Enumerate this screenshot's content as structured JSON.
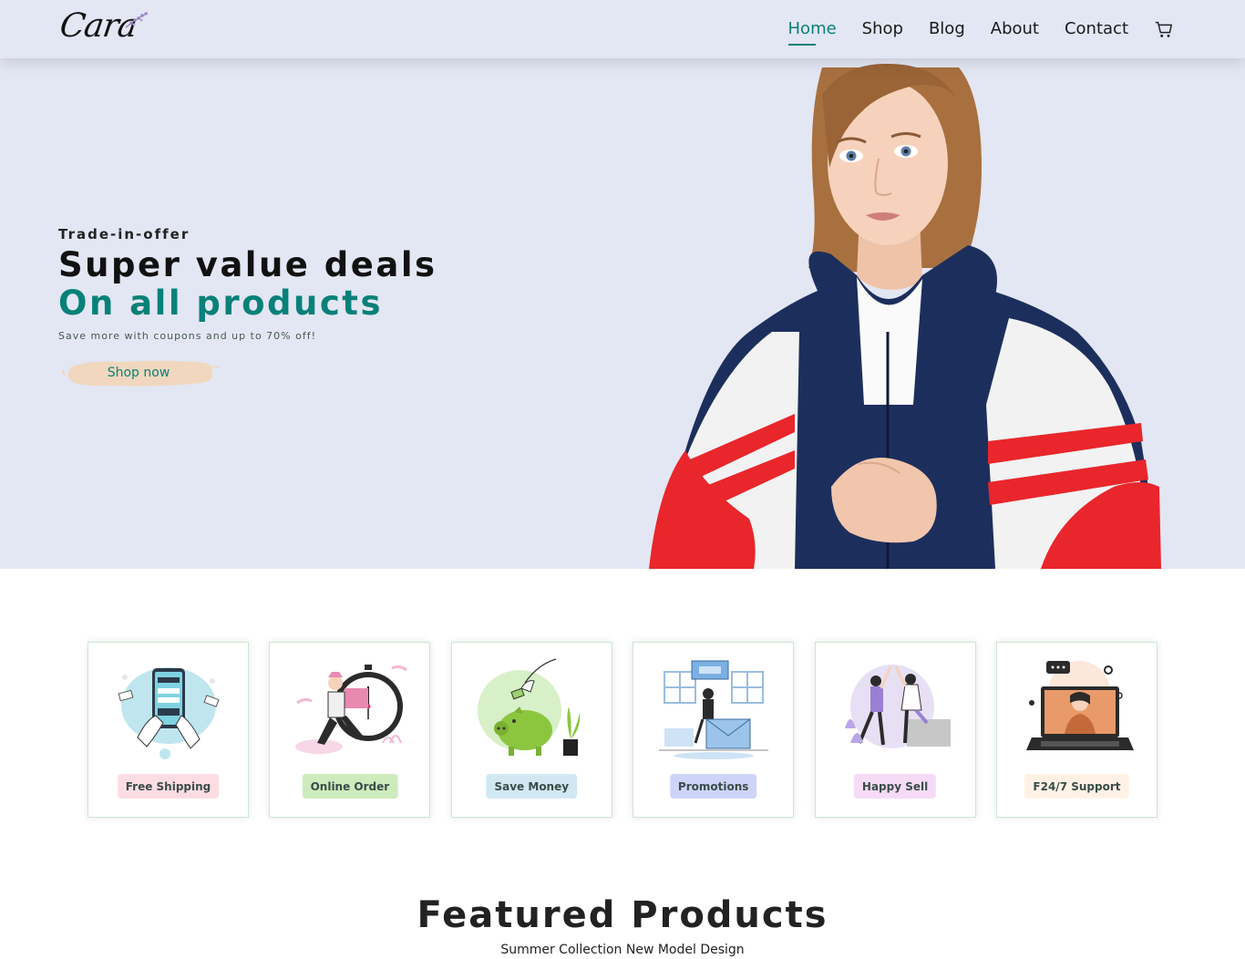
{
  "brand": {
    "logo_text": "Cara"
  },
  "nav": {
    "items": [
      {
        "label": "Home",
        "active": true
      },
      {
        "label": "Shop"
      },
      {
        "label": "Blog"
      },
      {
        "label": "About"
      },
      {
        "label": "Contact"
      }
    ],
    "cart_icon": "cart-icon"
  },
  "hero": {
    "kicker": "Trade-in-offer",
    "title_line1": "Super value deals",
    "title_line2": "On all products",
    "subtitle": "Save more with coupons and up to 70% off!",
    "button_label": "Shop now"
  },
  "features": [
    {
      "label": "Free Shipping",
      "color": "#fddde4",
      "icon": "phone-payment-illustration"
    },
    {
      "label": "Online Order",
      "color": "#cdebbc",
      "icon": "delivery-clock-illustration"
    },
    {
      "label": "Save Money",
      "color": "#d1e8f2",
      "icon": "piggy-bank-illustration"
    },
    {
      "label": "Promotions",
      "color": "#cdd4f8",
      "icon": "promotions-illustration"
    },
    {
      "label": "Happy Sell",
      "color": "#f6dbf6",
      "icon": "high-five-illustration"
    },
    {
      "label": "F24/7 Support",
      "color": "#fff2e5",
      "icon": "laptop-support-illustration"
    }
  ],
  "featured": {
    "title": "Featured Products",
    "subtitle": "Summer Collection New Model Design"
  },
  "colors": {
    "accent": "#088178",
    "nav_bg": "#e3e6f3",
    "button_brush": "#f0d7be"
  }
}
